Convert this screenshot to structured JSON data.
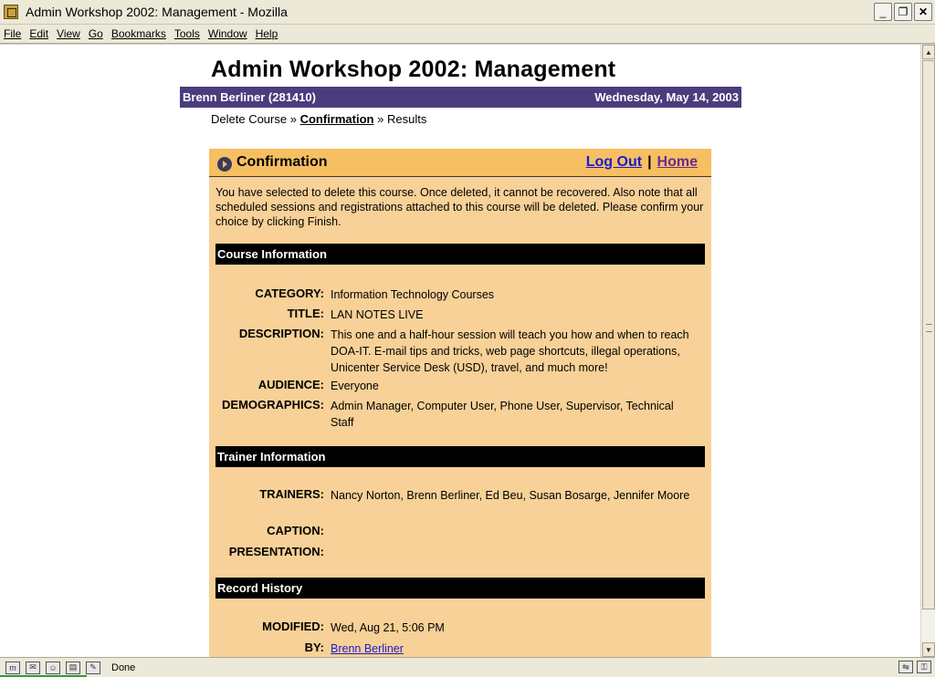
{
  "window": {
    "title": "Admin Workshop 2002: Management - Mozilla",
    "minimize_glyph": "_",
    "maximize_glyph": "❐",
    "close_glyph": "✕"
  },
  "menu": [
    "File",
    "Edit",
    "View",
    "Go",
    "Bookmarks",
    "Tools",
    "Window",
    "Help"
  ],
  "page": {
    "title": "Admin Workshop 2002: Management",
    "user": "Brenn Berliner (281410)",
    "date": "Wednesday, May 14, 2003",
    "breadcrumb": {
      "step1": "Delete Course",
      "sep1": "»",
      "step2": "Confirmation",
      "sep2": "»",
      "step3": "Results"
    }
  },
  "panel": {
    "title": "Confirmation",
    "logout": "Log Out",
    "separator": "|",
    "home": "Home",
    "intro": "You have selected to delete this course. Once deleted, it cannot be recovered. Also note that all scheduled sessions and registrations attached to this course will be deleted. Please confirm your choice by clicking Finish."
  },
  "course": {
    "heading": "Course Information",
    "category_label": "CATEGORY:",
    "category": "Information Technology Courses",
    "title_label": "TITLE:",
    "title": "LAN NOTES LIVE",
    "description_label": "DESCRIPTION:",
    "description": "This one and a half-hour session will teach you how and when to reach DOA-IT. E-mail tips and tricks, web page shortcuts, illegal operations, Unicenter Service Desk (USD), travel, and much more!",
    "audience_label": "AUDIENCE:",
    "audience": "Everyone",
    "demographics_label": "DEMOGRAPHICS:",
    "demographics": "Admin Manager, Computer User, Phone User, Supervisor, Technical Staff"
  },
  "trainer": {
    "heading": "Trainer Information",
    "trainers_label": "TRAINERS:",
    "trainers": "Nancy Norton, Brenn Berliner, Ed Beu, Susan Bosarge, Jennifer Moore",
    "caption_label": "CAPTION:",
    "caption": "",
    "presentation_label": "PRESENTATION:",
    "presentation": ""
  },
  "history": {
    "heading": "Record History",
    "modified_label": "MODIFIED:",
    "modified": "Wed, Aug 21, 5:06 PM",
    "by_label": "BY:",
    "by": "Brenn Berliner"
  },
  "status": {
    "text": "Done"
  },
  "colors": {
    "user_bar": "#4b3c7d",
    "panel_bg": "#f7d197",
    "panel_header": "#f6bf62",
    "link": "#1a1ad0",
    "visited_link": "#6a2b8f"
  }
}
